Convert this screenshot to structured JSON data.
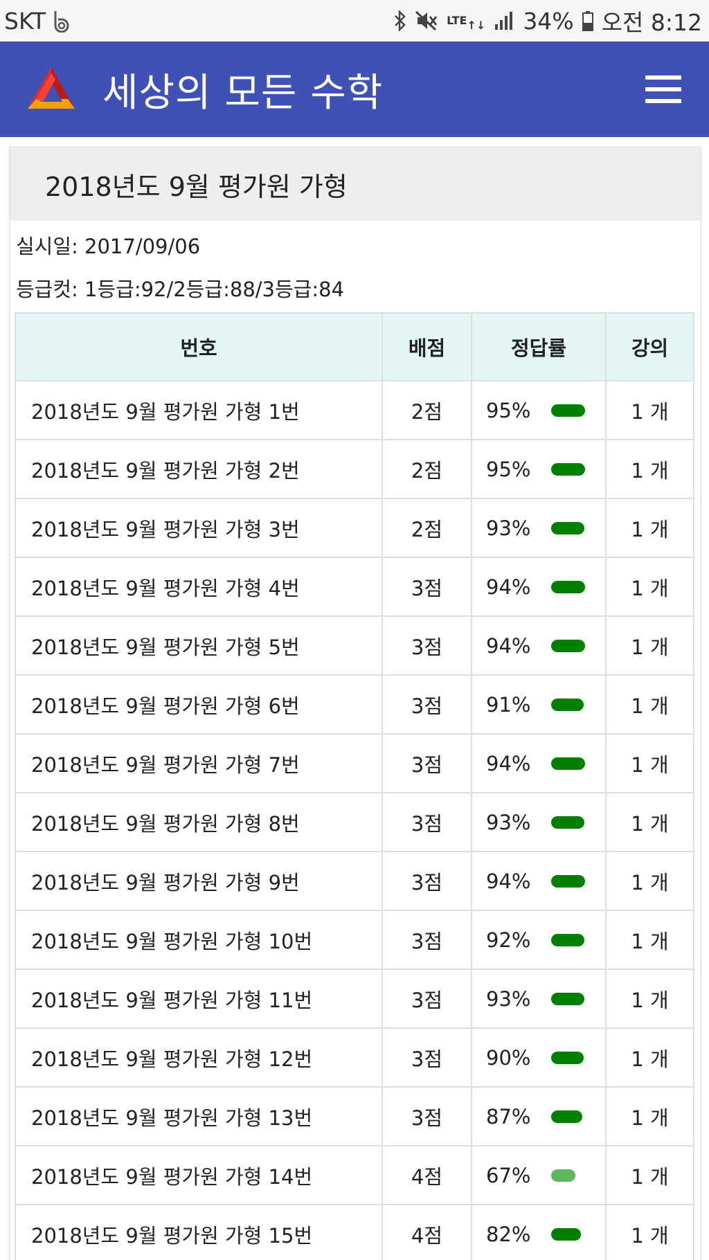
{
  "status_bar": {
    "carrier": "SKT",
    "battery": "34%",
    "time": "오전 8:12",
    "lte": "LTE"
  },
  "app": {
    "title": "세상의 모든 수학",
    "brand_color": "#3f51b5"
  },
  "exam": {
    "title": "2018년도 9월 평가원 가형",
    "date_line": "실시일: 2017/09/06",
    "cut_line": "등급컷: 1등급:92/2등급:88/3등급:84"
  },
  "table": {
    "headers": [
      "번호",
      "배점",
      "정답률",
      "강의"
    ],
    "rows": [
      {
        "name": "2018년도 9월 평가원 가형 1번",
        "points": "2점",
        "rate": "95%",
        "rate_value": 95,
        "lectures": "1 개"
      },
      {
        "name": "2018년도 9월 평가원 가형 2번",
        "points": "2점",
        "rate": "95%",
        "rate_value": 95,
        "lectures": "1 개"
      },
      {
        "name": "2018년도 9월 평가원 가형 3번",
        "points": "2점",
        "rate": "93%",
        "rate_value": 93,
        "lectures": "1 개"
      },
      {
        "name": "2018년도 9월 평가원 가형 4번",
        "points": "3점",
        "rate": "94%",
        "rate_value": 94,
        "lectures": "1 개"
      },
      {
        "name": "2018년도 9월 평가원 가형 5번",
        "points": "3점",
        "rate": "94%",
        "rate_value": 94,
        "lectures": "1 개"
      },
      {
        "name": "2018년도 9월 평가원 가형 6번",
        "points": "3점",
        "rate": "91%",
        "rate_value": 91,
        "lectures": "1 개"
      },
      {
        "name": "2018년도 9월 평가원 가형 7번",
        "points": "3점",
        "rate": "94%",
        "rate_value": 94,
        "lectures": "1 개"
      },
      {
        "name": "2018년도 9월 평가원 가형 8번",
        "points": "3점",
        "rate": "93%",
        "rate_value": 93,
        "lectures": "1 개"
      },
      {
        "name": "2018년도 9월 평가원 가형 9번",
        "points": "3점",
        "rate": "94%",
        "rate_value": 94,
        "lectures": "1 개"
      },
      {
        "name": "2018년도 9월 평가원 가형 10번",
        "points": "3점",
        "rate": "92%",
        "rate_value": 92,
        "lectures": "1 개"
      },
      {
        "name": "2018년도 9월 평가원 가형 11번",
        "points": "3점",
        "rate": "93%",
        "rate_value": 93,
        "lectures": "1 개"
      },
      {
        "name": "2018년도 9월 평가원 가형 12번",
        "points": "3점",
        "rate": "90%",
        "rate_value": 90,
        "lectures": "1 개"
      },
      {
        "name": "2018년도 9월 평가원 가형 13번",
        "points": "3점",
        "rate": "87%",
        "rate_value": 87,
        "lectures": "1 개"
      },
      {
        "name": "2018년도 9월 평가원 가형 14번",
        "points": "4점",
        "rate": "67%",
        "rate_value": 67,
        "lectures": "1 개"
      },
      {
        "name": "2018년도 9월 평가원 가형 15번",
        "points": "4점",
        "rate": "82%",
        "rate_value": 82,
        "lectures": "1 개"
      }
    ]
  }
}
